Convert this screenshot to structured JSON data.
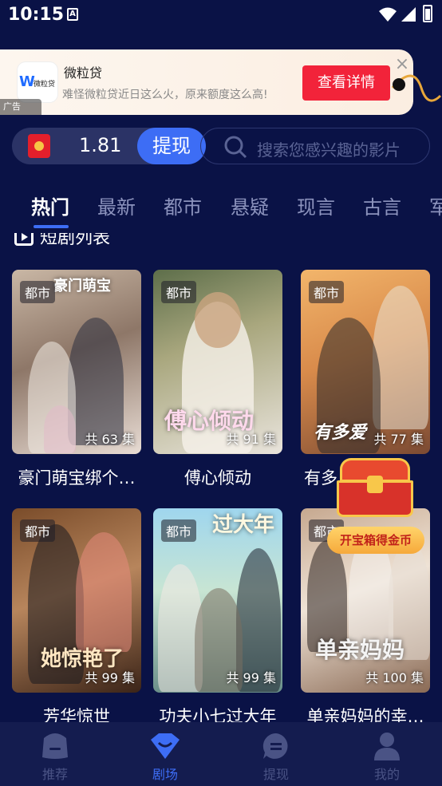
{
  "status_bar": {
    "time": "10:15",
    "indicator": "A"
  },
  "ad": {
    "logo_mark": "W",
    "logo_text": "微粒贷",
    "title": "微粒贷",
    "description": "难怪微粒贷近日这么火，原来额度这么高!",
    "cta": "查看详情",
    "tag": "广告",
    "close": "×"
  },
  "wallet": {
    "amount": "1.81",
    "withdraw_label": "提现"
  },
  "search": {
    "placeholder": "搜索您感兴趣的影片"
  },
  "tabs": [
    {
      "label": "热门",
      "active": true
    },
    {
      "label": "最新"
    },
    {
      "label": "都市"
    },
    {
      "label": "悬疑"
    },
    {
      "label": "现言"
    },
    {
      "label": "古言"
    },
    {
      "label": "军"
    }
  ],
  "section": {
    "title": "短剧列表"
  },
  "dramas": [
    {
      "title": "豪门萌宝绑个…",
      "genre": "都市",
      "episodes": "共 63 集",
      "poster_text": "豪门萌宝"
    },
    {
      "title": "傅心倾动",
      "genre": "都市",
      "episodes": "共 91 集",
      "poster_text": "傅心倾动"
    },
    {
      "title": "有多…",
      "genre": "都市",
      "episodes": "共 77 集",
      "poster_text": "有多爱"
    },
    {
      "title": "芳华惊世",
      "genre": "都市",
      "episodes": "共 99 集",
      "poster_text": "她惊艳了"
    },
    {
      "title": "功夫小七过大年",
      "genre": "都市",
      "episodes": "共 99 集",
      "poster_text": "过大年"
    },
    {
      "title": "单亲妈妈的幸…",
      "genre": "都市",
      "episodes": "共 100 集",
      "poster_text": "单亲妈妈"
    }
  ],
  "treasure": {
    "label": "开宝箱得金币"
  },
  "bottom_nav": [
    {
      "label": "推荐",
      "icon": "recommend-icon"
    },
    {
      "label": "剧场",
      "icon": "theater-icon",
      "active": true
    },
    {
      "label": "提现",
      "icon": "withdraw-icon"
    },
    {
      "label": "我的",
      "icon": "profile-icon"
    }
  ],
  "colors": {
    "background": "#0a1246",
    "accent": "#3d6df5",
    "ad_cta": "#f2233a"
  }
}
